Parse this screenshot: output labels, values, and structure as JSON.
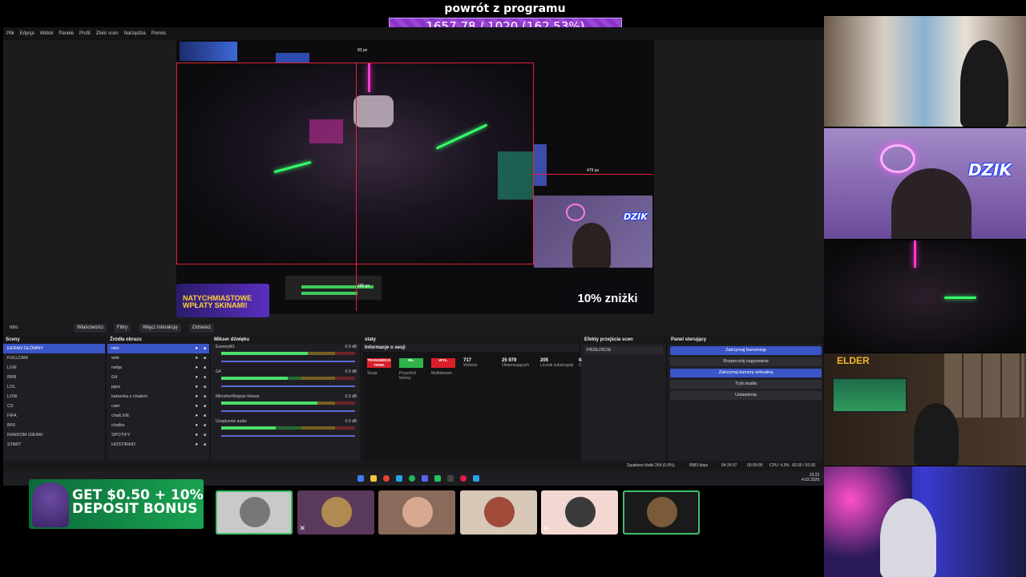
{
  "banner": {
    "title": "powrót z programu",
    "progress_text": "1657.78 / 1020 (162.53%)",
    "progress_percent": 162.53
  },
  "obs": {
    "menu": [
      "Plik",
      "Edycja",
      "Widok",
      "Panele",
      "Profil",
      "Zbiór scen",
      "Narzędzia",
      "Pomoc"
    ],
    "preview": {
      "measure_top": "83 px",
      "measure_right": "479 px",
      "measure_bottom": "186 px",
      "promo_text": "NATYCHMIASTOWE WPŁATY SKINAMI!",
      "discount_text": "10% zniżki",
      "dzik_logo": "DZIK"
    },
    "toolbar": {
      "selected_source": "ntro",
      "properties": "Właściwości",
      "filters": "Filtry",
      "interact": "Włącz interakcję",
      "refresh": "Odśwież"
    },
    "scenes": {
      "title": "Sceny",
      "items": [
        "EKRAN GŁÓWNY",
        "FULLCAM",
        "LIVE",
        "BRB",
        "LOL",
        "LOW",
        "CS",
        "FIFA",
        "BF6",
        "RANDOM GIERKI",
        "START"
      ],
      "selected_index": 0
    },
    "sources": {
      "title": "Źródła obrazu",
      "items": [
        "ntro",
        "widr",
        "nelija",
        "G4",
        "jajez",
        "kamerka z chatem",
        "cam",
        "chatLIVE",
        "chatbo",
        "SPOTIFY",
        "HOST/RAID"
      ],
      "selected_index": 0
    },
    "mixer": {
      "title": "Mikser dźwięku",
      "channels": [
        {
          "name": "ExeneyW1",
          "db": "0.0 dB",
          "level": 0.72
        },
        {
          "name": "G4",
          "db": "0.0 dB",
          "level": 0.55
        },
        {
          "name": "Mikrofon/Wejście liniowe",
          "db": "0.0 dB",
          "level": 0.8
        },
        {
          "name": "Urządzenie audio",
          "db": "0.0 dB",
          "level": 0.45
        }
      ]
    },
    "stats": {
      "dock_title": "staty",
      "panel_title": "Informacje o sesji",
      "badges": [
        "TRANSMISJA TRWA",
        "WŁ.",
        "WYŁ."
      ],
      "badge_labels": [
        "Sesja",
        "Przychód twórcy",
        "Multistream"
      ],
      "values": [
        {
          "value": "717",
          "label": "Widzów"
        },
        {
          "value": "25 979",
          "label": "Obserwujących"
        },
        {
          "value": "205",
          "label": "Licznik subskrypcji"
        },
        {
          "value": "04:24:31",
          "label": "Czas na żywo"
        }
      ]
    },
    "transitions": {
      "title": "Efekty przejścia scen",
      "selected": "PRZEJŚCIE"
    },
    "controls": {
      "title": "Panel sterujący",
      "buttons": [
        {
          "label": "Zatrzymaj transmisję",
          "active": true
        },
        {
          "label": "Rozpocznij nagrywanie",
          "active": false
        },
        {
          "label": "Zatrzymaj kamerę wirtualną",
          "active": true
        },
        {
          "label": "Tryb studia",
          "active": false
        },
        {
          "label": "Ustawienia",
          "active": false
        }
      ]
    },
    "status": {
      "dropped": "Zgubione klatki 264 (0.0%)",
      "bitrate": "8983 kbps",
      "live_time": "04:24:37",
      "rec_time": "00:00:00",
      "cpu": "CPU: 4.3%",
      "fps": "60.00 / 60.00 FPS"
    },
    "clock": {
      "time": "23:22",
      "date": "4.02.2026"
    }
  },
  "ad": {
    "line1": "GET $0.50 + 10%",
    "line2": "DEPOSIT BONUS"
  },
  "participants": [
    {
      "bg": "#c9c9c9",
      "avatar": "#777",
      "mic_off": false,
      "active": true
    },
    {
      "bg": "#5a3a5c",
      "avatar": "#b08a50",
      "mic_off": true,
      "active": false
    },
    {
      "bg": "#8a6a5a",
      "avatar": "#d8a890",
      "mic_off": false,
      "active": false
    },
    {
      "bg": "#d8c8b8",
      "avatar": "#a04a3a",
      "mic_off": false,
      "active": false
    },
    {
      "bg": "#f2d8d0",
      "avatar": "#3a3a3a",
      "mic_off": true,
      "active": false
    },
    {
      "bg": "#1a1a1a",
      "avatar": "#7a5a3a",
      "mic_off": false,
      "active": true
    }
  ],
  "cams": {
    "cam2_logo": "DZIK",
    "cam4_logo": "ELDER"
  }
}
